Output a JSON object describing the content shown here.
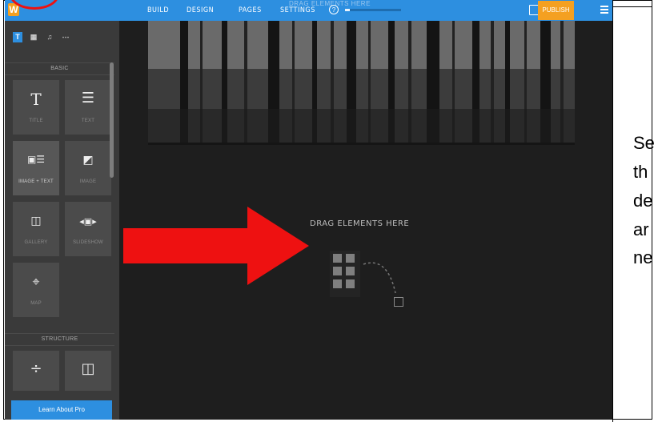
{
  "app": {
    "logo": "W",
    "nav": [
      "BUILD",
      "DESIGN",
      "PAGES",
      "SETTINGS"
    ],
    "help_icon": "?",
    "progress_fraction": 0.08,
    "top_ghost_text": "DRAG ELEMENTS HERE",
    "publish_label": "PUBLISH"
  },
  "sidebar": {
    "tabs": [
      "T",
      "▦",
      "♫",
      "⋯"
    ],
    "sections": {
      "basic": "BASIC",
      "structure": "STRUCTURE"
    },
    "elements": [
      {
        "label": "TITLE",
        "icon": "title-icon",
        "glyph": "T"
      },
      {
        "label": "TEXT",
        "icon": "text-icon",
        "glyph": "☰"
      },
      {
        "label": "IMAGE + TEXT",
        "icon": "image-text-icon",
        "glyph": "▣☰"
      },
      {
        "label": "IMAGE",
        "icon": "image-icon",
        "glyph": "◩"
      },
      {
        "label": "GALLERY",
        "icon": "gallery-icon",
        "glyph": "◫"
      },
      {
        "label": "SLIDESHOW",
        "icon": "slideshow-icon",
        "glyph": "◂▣▸"
      },
      {
        "label": "MAP",
        "icon": "map-pin-icon",
        "glyph": "⌖"
      }
    ],
    "structure_glyphs": [
      "÷",
      "◫"
    ],
    "learn_pro": "Learn About Pro"
  },
  "canvas": {
    "dropzone_text": "DRAG ELEMENTS HERE"
  },
  "annotation": {
    "lines": [
      "Se",
      "th",
      "de",
      "ar",
      "ne"
    ],
    "arrow_color": "#ee1111"
  },
  "colors": {
    "accent": "#2d8fe0",
    "publish": "#f4a021",
    "background": "#1e1e1e"
  }
}
